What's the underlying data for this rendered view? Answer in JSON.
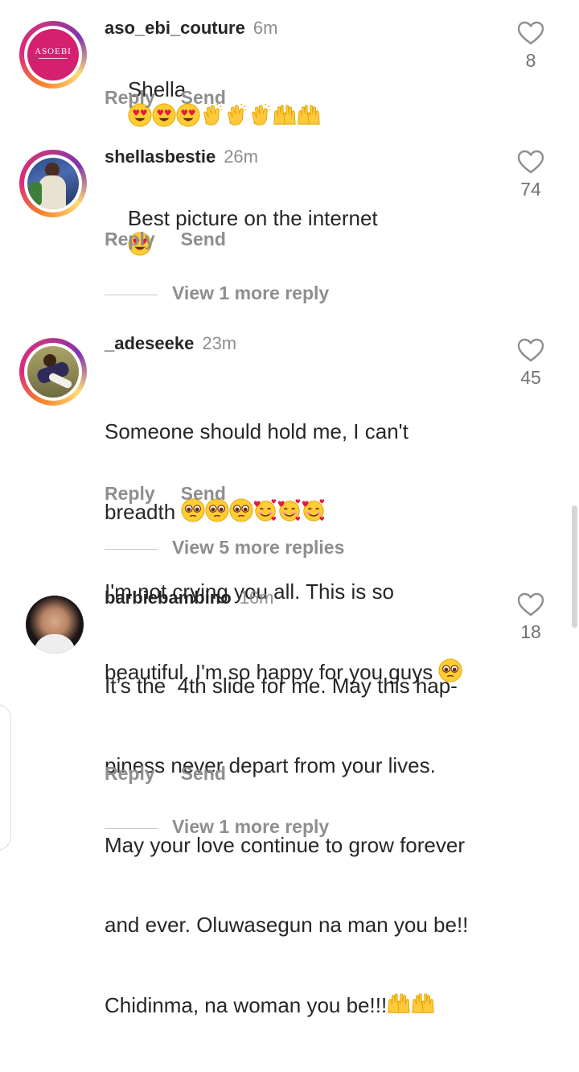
{
  "comments": [
    {
      "username": "aso_ebi_couture",
      "time": "6m",
      "text": "Shella",
      "emoji": [
        "heart-eyes",
        "heart-eyes",
        "heart-eyes",
        "clap",
        "clap",
        "clap",
        "raised-hands",
        "raised-hands"
      ],
      "likes": "8",
      "reply_label": "Reply",
      "send_label": "Send",
      "avatar_text": "ASOEBI"
    },
    {
      "username": "shellasbestie",
      "time": "26m",
      "text": "Best picture on the internet",
      "emoji": [
        "heart-eyes"
      ],
      "likes": "74",
      "reply_label": "Reply",
      "send_label": "Send",
      "view_more": "View 1 more reply"
    },
    {
      "username": "_adeseeke",
      "time": "23m",
      "text_line1": "Someone should hold me, I can't",
      "text_line2": "breadth",
      "text_line3": "I'm not crying you all. This is so",
      "text_line4": "beautiful. I'm so happy for you guys",
      "likes": "45",
      "reply_label": "Reply",
      "send_label": "Send",
      "view_more": "View 5 more replies"
    },
    {
      "username": "barbiebambino",
      "time": "16m",
      "text_line1": "It’s the  4th slide for me. May this hap-",
      "text_line2": "piness never depart from your lives.",
      "text_line3": "May your love continue to grow forever",
      "text_line4": "and ever. Oluwasegun na man you be!!",
      "text_line5": "Chidinma, na woman you be!!!",
      "likes": "18",
      "reply_label": "Reply",
      "send_label": "Send",
      "view_more": "View 1 more reply"
    }
  ],
  "colors": {
    "text": "#262626",
    "secondary": "#8e8e8e",
    "ring_start": "#f58529",
    "ring_end": "#8134af",
    "brand_pink": "#d4206f"
  }
}
